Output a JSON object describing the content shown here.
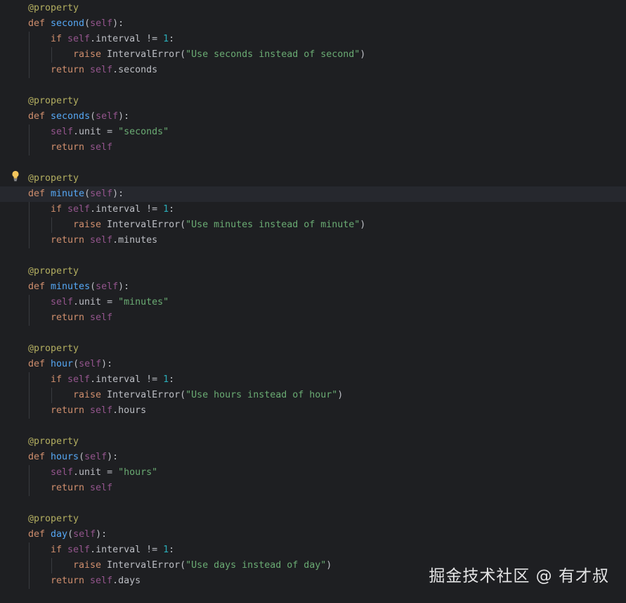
{
  "editor": {
    "lines": [
      {
        "indent": 0,
        "tokens": [
          {
            "t": "@property",
            "c": "dec"
          }
        ]
      },
      {
        "indent": 0,
        "tokens": [
          {
            "t": "def ",
            "c": "kw"
          },
          {
            "t": "second",
            "c": "fn"
          },
          {
            "t": "(",
            "c": "txt"
          },
          {
            "t": "self",
            "c": "slf"
          },
          {
            "t": "):",
            "c": "txt"
          }
        ]
      },
      {
        "indent": 1,
        "tokens": [
          {
            "t": "if ",
            "c": "kw"
          },
          {
            "t": "self",
            "c": "slf"
          },
          {
            "t": ".interval != ",
            "c": "txt"
          },
          {
            "t": "1",
            "c": "num"
          },
          {
            "t": ":",
            "c": "txt"
          }
        ]
      },
      {
        "indent": 2,
        "tokens": [
          {
            "t": "raise ",
            "c": "kw"
          },
          {
            "t": "IntervalError(",
            "c": "txt"
          },
          {
            "t": "\"Use seconds instead of second\"",
            "c": "str"
          },
          {
            "t": ")",
            "c": "txt"
          }
        ]
      },
      {
        "indent": 1,
        "tokens": [
          {
            "t": "return ",
            "c": "kw"
          },
          {
            "t": "self",
            "c": "slf"
          },
          {
            "t": ".seconds",
            "c": "txt"
          }
        ]
      },
      {
        "indent": -1,
        "tokens": []
      },
      {
        "indent": 0,
        "tokens": [
          {
            "t": "@property",
            "c": "dec"
          }
        ]
      },
      {
        "indent": 0,
        "tokens": [
          {
            "t": "def ",
            "c": "kw"
          },
          {
            "t": "seconds",
            "c": "fn"
          },
          {
            "t": "(",
            "c": "txt"
          },
          {
            "t": "self",
            "c": "slf"
          },
          {
            "t": "):",
            "c": "txt"
          }
        ]
      },
      {
        "indent": 1,
        "tokens": [
          {
            "t": "self",
            "c": "slf"
          },
          {
            "t": ".unit = ",
            "c": "txt"
          },
          {
            "t": "\"seconds\"",
            "c": "str"
          }
        ]
      },
      {
        "indent": 1,
        "tokens": [
          {
            "t": "return ",
            "c": "kw"
          },
          {
            "t": "self",
            "c": "slf"
          }
        ]
      },
      {
        "indent": -1,
        "tokens": []
      },
      {
        "indent": 0,
        "tokens": [
          {
            "t": "@property",
            "c": "dec"
          }
        ]
      },
      {
        "indent": 0,
        "current": true,
        "tokens": [
          {
            "t": "def ",
            "c": "kw"
          },
          {
            "t": "minute",
            "c": "fn"
          },
          {
            "t": "(",
            "c": "txt"
          },
          {
            "t": "self",
            "c": "slf"
          },
          {
            "t": "):",
            "c": "txt"
          }
        ]
      },
      {
        "indent": 1,
        "tokens": [
          {
            "t": "if ",
            "c": "kw"
          },
          {
            "t": "self",
            "c": "slf"
          },
          {
            "t": ".interval != ",
            "c": "txt"
          },
          {
            "t": "1",
            "c": "num"
          },
          {
            "t": ":",
            "c": "txt"
          }
        ]
      },
      {
        "indent": 2,
        "tokens": [
          {
            "t": "raise ",
            "c": "kw"
          },
          {
            "t": "IntervalError(",
            "c": "txt"
          },
          {
            "t": "\"Use minutes instead of minute\"",
            "c": "str"
          },
          {
            "t": ")",
            "c": "txt"
          }
        ]
      },
      {
        "indent": 1,
        "tokens": [
          {
            "t": "return ",
            "c": "kw"
          },
          {
            "t": "self",
            "c": "slf"
          },
          {
            "t": ".minutes",
            "c": "txt"
          }
        ]
      },
      {
        "indent": -1,
        "tokens": []
      },
      {
        "indent": 0,
        "tokens": [
          {
            "t": "@property",
            "c": "dec"
          }
        ]
      },
      {
        "indent": 0,
        "tokens": [
          {
            "t": "def ",
            "c": "kw"
          },
          {
            "t": "minutes",
            "c": "fn"
          },
          {
            "t": "(",
            "c": "txt"
          },
          {
            "t": "self",
            "c": "slf"
          },
          {
            "t": "):",
            "c": "txt"
          }
        ]
      },
      {
        "indent": 1,
        "tokens": [
          {
            "t": "self",
            "c": "slf"
          },
          {
            "t": ".unit = ",
            "c": "txt"
          },
          {
            "t": "\"minutes\"",
            "c": "str"
          }
        ]
      },
      {
        "indent": 1,
        "tokens": [
          {
            "t": "return ",
            "c": "kw"
          },
          {
            "t": "self",
            "c": "slf"
          }
        ]
      },
      {
        "indent": -1,
        "tokens": []
      },
      {
        "indent": 0,
        "tokens": [
          {
            "t": "@property",
            "c": "dec"
          }
        ]
      },
      {
        "indent": 0,
        "tokens": [
          {
            "t": "def ",
            "c": "kw"
          },
          {
            "t": "hour",
            "c": "fn"
          },
          {
            "t": "(",
            "c": "txt"
          },
          {
            "t": "self",
            "c": "slf"
          },
          {
            "t": "):",
            "c": "txt"
          }
        ]
      },
      {
        "indent": 1,
        "tokens": [
          {
            "t": "if ",
            "c": "kw"
          },
          {
            "t": "self",
            "c": "slf"
          },
          {
            "t": ".interval != ",
            "c": "txt"
          },
          {
            "t": "1",
            "c": "num"
          },
          {
            "t": ":",
            "c": "txt"
          }
        ]
      },
      {
        "indent": 2,
        "tokens": [
          {
            "t": "raise ",
            "c": "kw"
          },
          {
            "t": "IntervalError(",
            "c": "txt"
          },
          {
            "t": "\"Use hours instead of hour\"",
            "c": "str"
          },
          {
            "t": ")",
            "c": "txt"
          }
        ]
      },
      {
        "indent": 1,
        "tokens": [
          {
            "t": "return ",
            "c": "kw"
          },
          {
            "t": "self",
            "c": "slf"
          },
          {
            "t": ".hours",
            "c": "txt"
          }
        ]
      },
      {
        "indent": -1,
        "tokens": []
      },
      {
        "indent": 0,
        "tokens": [
          {
            "t": "@property",
            "c": "dec"
          }
        ]
      },
      {
        "indent": 0,
        "tokens": [
          {
            "t": "def ",
            "c": "kw"
          },
          {
            "t": "hours",
            "c": "fn"
          },
          {
            "t": "(",
            "c": "txt"
          },
          {
            "t": "self",
            "c": "slf"
          },
          {
            "t": "):",
            "c": "txt"
          }
        ]
      },
      {
        "indent": 1,
        "tokens": [
          {
            "t": "self",
            "c": "slf"
          },
          {
            "t": ".unit = ",
            "c": "txt"
          },
          {
            "t": "\"hours\"",
            "c": "str"
          }
        ]
      },
      {
        "indent": 1,
        "tokens": [
          {
            "t": "return ",
            "c": "kw"
          },
          {
            "t": "self",
            "c": "slf"
          }
        ]
      },
      {
        "indent": -1,
        "tokens": []
      },
      {
        "indent": 0,
        "tokens": [
          {
            "t": "@property",
            "c": "dec"
          }
        ]
      },
      {
        "indent": 0,
        "tokens": [
          {
            "t": "def ",
            "c": "kw"
          },
          {
            "t": "day",
            "c": "fn"
          },
          {
            "t": "(",
            "c": "txt"
          },
          {
            "t": "self",
            "c": "slf"
          },
          {
            "t": "):",
            "c": "txt"
          }
        ]
      },
      {
        "indent": 1,
        "tokens": [
          {
            "t": "if ",
            "c": "kw"
          },
          {
            "t": "self",
            "c": "slf"
          },
          {
            "t": ".interval != ",
            "c": "txt"
          },
          {
            "t": "1",
            "c": "num"
          },
          {
            "t": ":",
            "c": "txt"
          }
        ]
      },
      {
        "indent": 2,
        "tokens": [
          {
            "t": "raise ",
            "c": "kw"
          },
          {
            "t": "IntervalError(",
            "c": "txt"
          },
          {
            "t": "\"Use days instead of day\"",
            "c": "str"
          },
          {
            "t": ")",
            "c": "txt"
          }
        ]
      },
      {
        "indent": 1,
        "tokens": [
          {
            "t": "return ",
            "c": "kw"
          },
          {
            "t": "self",
            "c": "slf"
          },
          {
            "t": ".days",
            "c": "txt"
          }
        ]
      }
    ],
    "intention_icon": "lightbulb-icon"
  },
  "watermark": {
    "text": "掘金技术社区 @ 有才叔"
  },
  "colors": {
    "background": "#1e1f22",
    "current_line": "#26282e",
    "keyword": "#cf8e6d",
    "function": "#56a8f5",
    "self": "#94558d",
    "string": "#6aab73",
    "number": "#2aacb8",
    "decorator": "#b3ae60",
    "text": "#bcbec4"
  }
}
